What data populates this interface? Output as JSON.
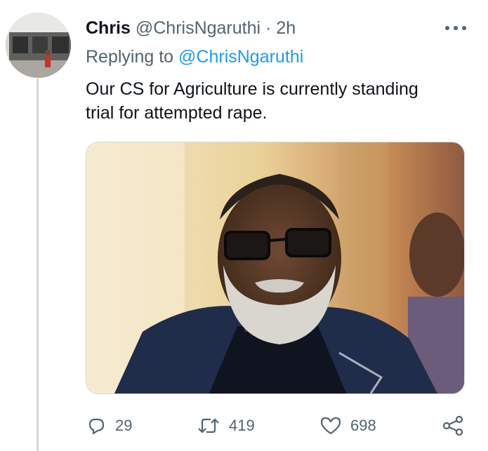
{
  "tweet": {
    "author_name": "Chris",
    "author_handle": "@ChrisNgaruthi",
    "separator": "·",
    "time": "2h",
    "replying_prefix": "Replying to",
    "replying_to": "@ChrisNgaruthi",
    "text_line1": "Our CS for Agriculture is currently standing",
    "text_line2": "trial for attempted rape.",
    "media_icon": "photo",
    "more_icon": "more-horizontal-icon"
  },
  "actions": {
    "reply_count": "29",
    "retweet_count": "419",
    "like_count": "698",
    "icons": [
      "reply-icon",
      "retweet-icon",
      "like-icon",
      "share-icon"
    ]
  },
  "colors": {
    "text": "#0f1419",
    "secondary": "#536471",
    "link": "#1d9bf0",
    "border": "#cfd9de"
  }
}
